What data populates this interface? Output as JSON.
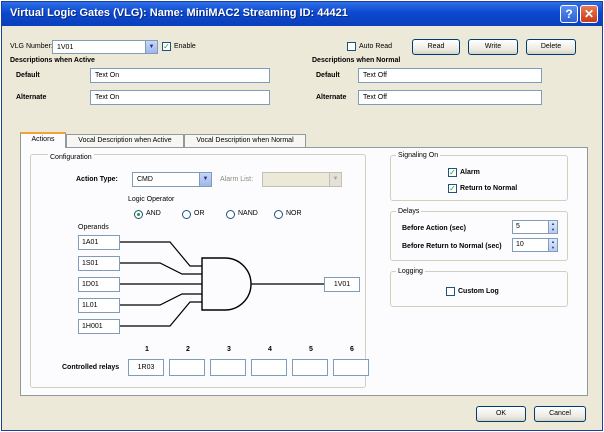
{
  "window": {
    "title": "Virtual Logic Gates (VLG): Name: MiniMAC2 Streaming ID: 44421",
    "help_glyph": "?",
    "close_glyph": "✕"
  },
  "top": {
    "vlg_label": "VLG Number:",
    "vlg_value": "1V01",
    "enable_label": "Enable",
    "auto_read_label": "Auto Read",
    "read_label": "Read",
    "write_label": "Write",
    "delete_label": "Delete"
  },
  "desc_active": {
    "heading": "Descriptions when Active",
    "default_label": "Default",
    "default_value": "Text On",
    "alternate_label": "Alternate",
    "alternate_value": "Text On"
  },
  "desc_normal": {
    "heading": "Descriptions when Normal",
    "default_label": "Default",
    "default_value": "Text Off",
    "alternate_label": "Alternate",
    "alternate_value": "Text Off"
  },
  "tabs": [
    "Actions",
    "Vocal Description when Active",
    "Vocal Description when Normal"
  ],
  "configuration": {
    "heading": "Configuration",
    "action_type_label": "Action Type:",
    "action_type_value": "CMD",
    "alarm_list_label": "Alarm List:",
    "alarm_list_value": "",
    "logic_operator_label": "Logic Operator",
    "operators": [
      "AND",
      "OR",
      "NAND",
      "NOR"
    ],
    "operands_label": "Operands",
    "operands": [
      "1A01",
      "1S01",
      "1D01",
      "1L01",
      "1H001"
    ],
    "output": "1V01",
    "relay_numbers": [
      "1",
      "2",
      "3",
      "4",
      "5",
      "6"
    ],
    "controlled_relays_label": "Controlled relays",
    "relays": [
      "1R03",
      "",
      "",
      "",
      "",
      ""
    ]
  },
  "signaling": {
    "heading": "Signaling On",
    "alarm_label": "Alarm",
    "rtn_label": "Return to Normal"
  },
  "delays": {
    "heading": "Delays",
    "before_action_label": "Before Action (sec)",
    "before_action_value": "5",
    "before_rtn_label": "Before Return to Normal (sec)",
    "before_rtn_value": "10"
  },
  "logging": {
    "heading": "Logging",
    "custom_log_label": "Custom Log"
  },
  "footer": {
    "ok_label": "OK",
    "cancel_label": "Cancel"
  },
  "colors": {
    "title_bar": "#0b48d0",
    "check_mark": "#21a121",
    "tab_highlight": "#f1a33a"
  }
}
